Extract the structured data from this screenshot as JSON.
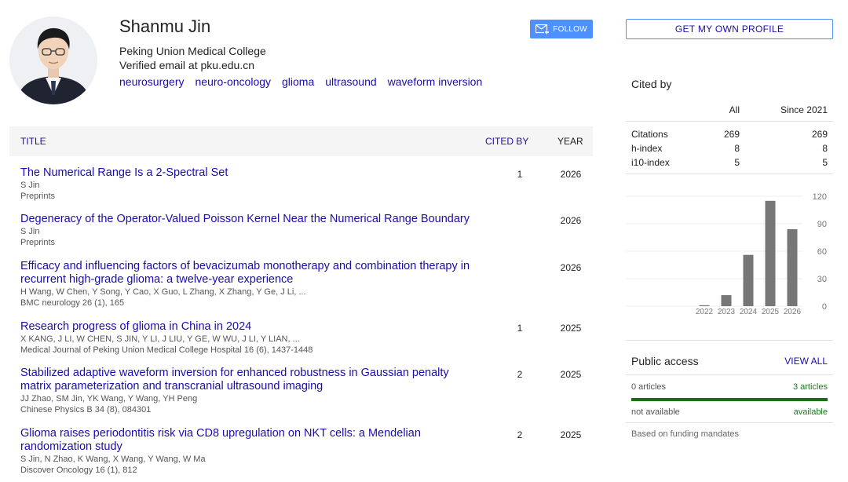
{
  "profile": {
    "name": "Shanmu Jin",
    "affiliation": "Peking Union Medical College",
    "email": "Verified email at pku.edu.cn",
    "interests": [
      "neurosurgery",
      "neuro-oncology",
      "glioma",
      "ultrasound",
      "waveform inversion"
    ]
  },
  "buttons": {
    "follow": "FOLLOW",
    "get_own_profile": "GET MY OWN PROFILE"
  },
  "table": {
    "headers": {
      "title": "TITLE",
      "cited_by": "CITED BY",
      "year": "YEAR"
    },
    "rows": [
      {
        "title": "The Numerical Range Is a 2-Spectral Set",
        "authors": "S Jin",
        "venue": "Preprints",
        "cited_by": "1",
        "year": "2026"
      },
      {
        "title": "Degeneracy of the Operator-Valued Poisson Kernel Near the Numerical Range Boundary",
        "authors": "S Jin",
        "venue": "Preprints",
        "cited_by": "",
        "year": "2026"
      },
      {
        "title": "Efficacy and influencing factors of bevacizumab monotherapy and combination therapy in recurrent high-grade glioma: a twelve-year experience",
        "authors": "H Wang, W Chen, Y Song, Y Cao, X Guo, L Zhang, X Zhang, Y Ge, J Li, ...",
        "venue": "BMC neurology 26 (1), 165",
        "cited_by": "",
        "year": "2026"
      },
      {
        "title": "Research progress of glioma in China in 2024",
        "authors": "X KANG, J LI, W CHEN, S JIN, Y LI, J LIU, Y GE, W WU, J LI, Y LIAN, ...",
        "venue": "Medical Journal of Peking Union Medical College Hospital 16 (6), 1437-1448",
        "cited_by": "1",
        "year": "2025"
      },
      {
        "title": "Stabilized adaptive waveform inversion for enhanced robustness in Gaussian penalty matrix parameterization and transcranial ultrasound imaging",
        "authors": "JJ Zhao, SM Jin, YK Wang, Y Wang, YH Peng",
        "venue": "Chinese Physics B 34 (8), 084301",
        "cited_by": "2",
        "year": "2025"
      },
      {
        "title": "Glioma raises periodontitis risk via CD8 upregulation on NKT cells: a Mendelian randomization study",
        "authors": "S Jin, N Zhao, K Wang, X Wang, Y Wang, W Ma",
        "venue": "Discover Oncology 16 (1), 812",
        "cited_by": "2",
        "year": "2025"
      }
    ]
  },
  "cited_by": {
    "title": "Cited by",
    "col_all": "All",
    "col_since": "Since 2021",
    "metrics": [
      {
        "label": "Citations",
        "all": "269",
        "since": "269"
      },
      {
        "label": "h-index",
        "all": "8",
        "since": "8"
      },
      {
        "label": "i10-index",
        "all": "5",
        "since": "5"
      }
    ]
  },
  "chart_data": {
    "type": "bar",
    "categories": [
      "2022",
      "2023",
      "2024",
      "2025",
      "2026"
    ],
    "values": [
      1,
      12,
      56,
      115,
      84
    ],
    "yticks": [
      "120",
      "90",
      "60",
      "30",
      "0"
    ],
    "ylim": [
      0,
      120
    ],
    "color": "#777777"
  },
  "public_access": {
    "title": "Public access",
    "view_all": "VIEW ALL",
    "not_available_count": "0 articles",
    "available_count": "3 articles",
    "not_available_label": "not available",
    "available_label": "available",
    "mandates": "Based on funding mandates"
  },
  "colors": {
    "link": "#1a0dab",
    "follow_button": "#4d90fe",
    "available": "#1a6b1a"
  }
}
